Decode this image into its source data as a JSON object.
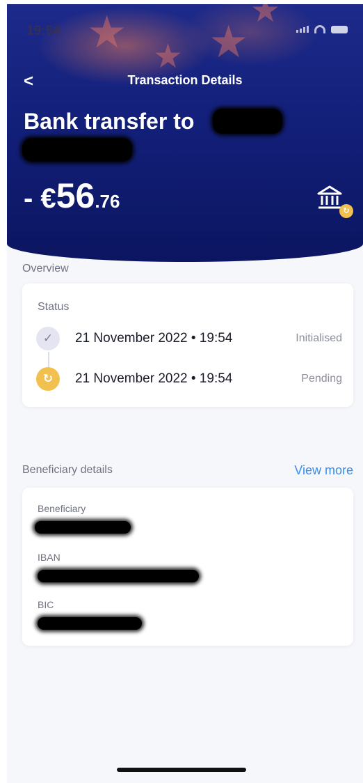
{
  "status_bar": {
    "time": "19:54"
  },
  "nav": {
    "back_label": "<",
    "title": "Transaction Details"
  },
  "header": {
    "headline": "Bank transfer to",
    "amount_sign": "- €",
    "amount_main": "56",
    "amount_cents": ".76",
    "bank_badge": "↻"
  },
  "overview": {
    "section_label": "Overview",
    "status_label": "Status",
    "rows": [
      {
        "date": "21 November 2022 • 19:54",
        "state": "Initialised",
        "icon": "check-icon"
      },
      {
        "date": "21 November 2022 • 19:54",
        "state": "Pending",
        "icon": "refresh-icon"
      }
    ]
  },
  "beneficiary": {
    "section_label": "Beneficiary details",
    "view_more": "View more",
    "fields": [
      {
        "label": "Beneficiary"
      },
      {
        "label": "IBAN"
      },
      {
        "label": "BIC"
      }
    ]
  },
  "colors": {
    "accent_link": "#3b8de8",
    "pending": "#f2c04f",
    "header_bg": "#13207a"
  }
}
